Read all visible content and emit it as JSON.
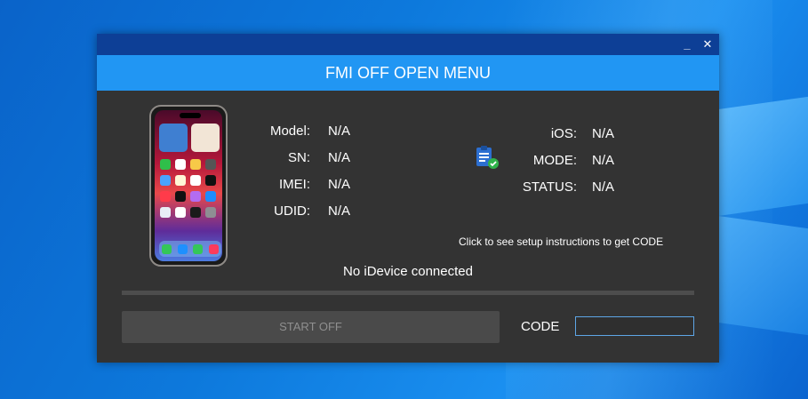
{
  "window": {
    "minimize_glyph": "_",
    "close_glyph": "✕",
    "header_title": "FMI OFF OPEN MENU"
  },
  "device_info": {
    "left": [
      {
        "label": "Model:",
        "value": "N/A"
      },
      {
        "label": "SN:",
        "value": "N/A"
      },
      {
        "label": "IMEI:",
        "value": "N/A"
      },
      {
        "label": "UDID:",
        "value": "N/A"
      }
    ],
    "right": [
      {
        "label": "iOS:",
        "value": "N/A"
      },
      {
        "label": "MODE:",
        "value": "N/A"
      },
      {
        "label": "STATUS:",
        "value": "N/A"
      }
    ]
  },
  "instructions_link": "Click to see setup instructions to get CODE",
  "connection_status": "No iDevice connected",
  "actions": {
    "start_label": "START OFF",
    "code_label": "CODE",
    "code_value": ""
  },
  "icons": {
    "phone": "iphone-image",
    "clipboard": "clipboard-check-icon"
  },
  "colors": {
    "window_bg": "#333333",
    "titlebar": "#0d3f96",
    "header": "#2196f3",
    "start_button_disabled": "#4a4a4a",
    "input_border": "#5ea6e6"
  }
}
